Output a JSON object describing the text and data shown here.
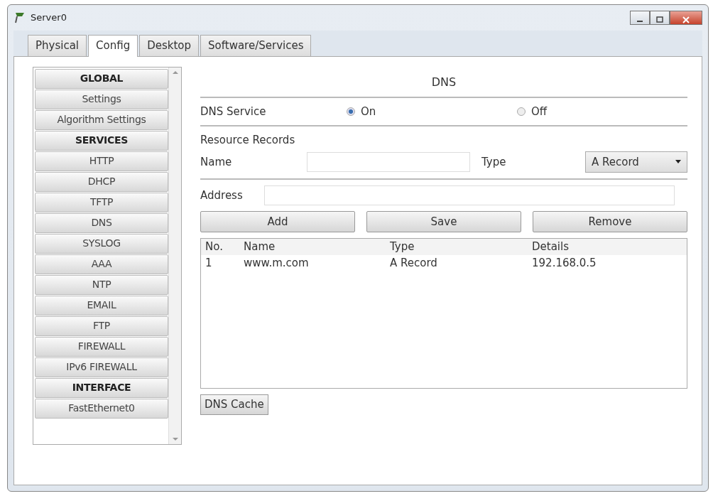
{
  "window": {
    "title": "Server0"
  },
  "tabs": [
    {
      "label": "Physical",
      "selected": false
    },
    {
      "label": "Config",
      "selected": true
    },
    {
      "label": "Desktop",
      "selected": false
    },
    {
      "label": "Software/Services",
      "selected": false
    }
  ],
  "sidebar": {
    "items": [
      {
        "label": "GLOBAL",
        "kind": "header",
        "selected": false
      },
      {
        "label": "Settings",
        "kind": "item",
        "selected": false
      },
      {
        "label": "Algorithm Settings",
        "kind": "item",
        "selected": false
      },
      {
        "label": "SERVICES",
        "kind": "header",
        "selected": false
      },
      {
        "label": "HTTP",
        "kind": "item",
        "selected": false
      },
      {
        "label": "DHCP",
        "kind": "item",
        "selected": false
      },
      {
        "label": "TFTP",
        "kind": "item",
        "selected": false
      },
      {
        "label": "DNS",
        "kind": "item",
        "selected": false
      },
      {
        "label": "SYSLOG",
        "kind": "item",
        "selected": false
      },
      {
        "label": "AAA",
        "kind": "item",
        "selected": false
      },
      {
        "label": "NTP",
        "kind": "item",
        "selected": false
      },
      {
        "label": "EMAIL",
        "kind": "item",
        "selected": false
      },
      {
        "label": "FTP",
        "kind": "item",
        "selected": false
      },
      {
        "label": "FIREWALL",
        "kind": "item",
        "selected": false
      },
      {
        "label": "IPv6 FIREWALL",
        "kind": "item",
        "selected": false
      },
      {
        "label": "INTERFACE",
        "kind": "header",
        "selected": false
      },
      {
        "label": "FastEthernet0",
        "kind": "item",
        "selected": false
      }
    ]
  },
  "panel": {
    "title": "DNS",
    "service": {
      "label": "DNS Service",
      "options": [
        {
          "label": "On",
          "selected": true
        },
        {
          "label": "Off",
          "selected": false
        }
      ]
    },
    "records_label": "Resource Records",
    "name_label": "Name",
    "type_label": "Type",
    "type_value": "A Record",
    "address_label": "Address",
    "buttons": [
      "Add",
      "Save",
      "Remove"
    ],
    "table": {
      "columns": [
        "No.",
        "Name",
        "Type",
        "Details"
      ],
      "rows": [
        [
          "1",
          "www.m.com",
          "A Record",
          "192.168.0.5"
        ]
      ]
    },
    "cache_button": "DNS Cache"
  }
}
